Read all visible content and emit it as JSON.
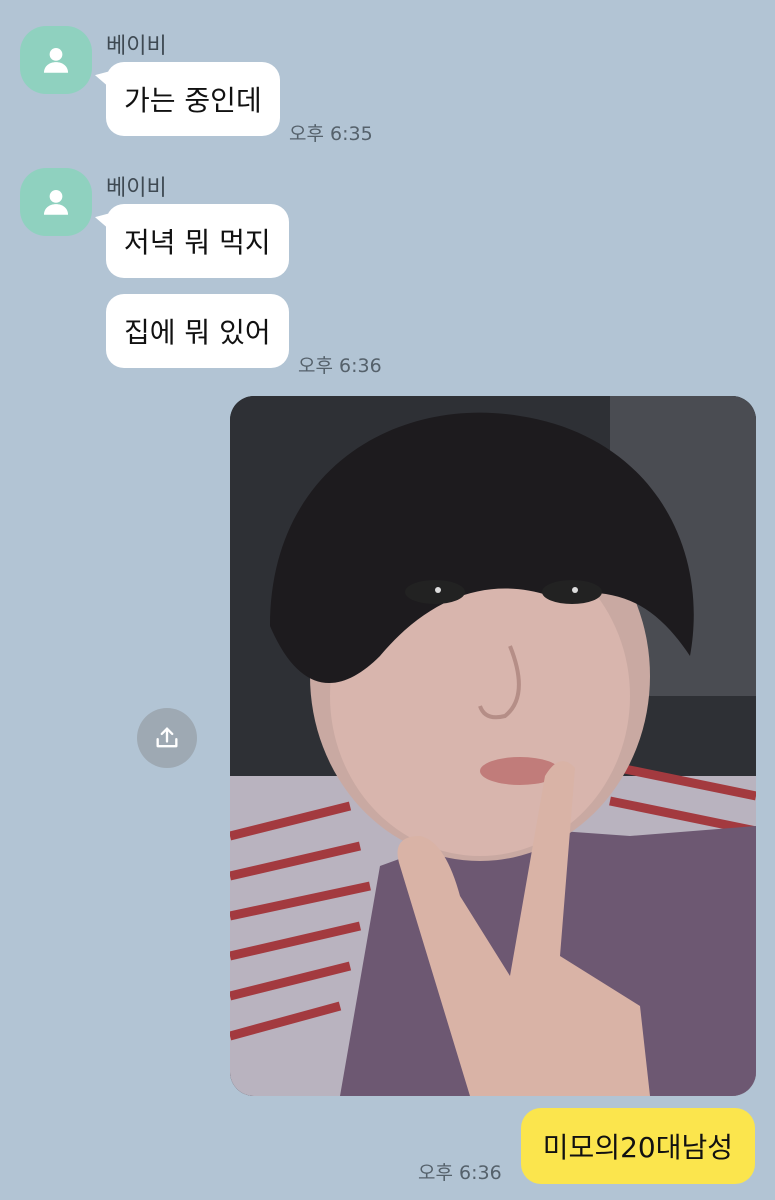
{
  "contact": {
    "name": "베이비",
    "avatar_icon": "person-icon"
  },
  "messages": [
    {
      "from": "contact",
      "show_sender": true,
      "text": "가는 중인데",
      "time": "오후 6:35"
    },
    {
      "from": "contact",
      "show_sender": true,
      "text": "저녁 뭐 먹지",
      "time": ""
    },
    {
      "from": "contact",
      "show_sender": false,
      "text": "집에 뭐 있어",
      "time": "오후 6:36"
    },
    {
      "from": "me",
      "type": "photo",
      "share_icon": "share-icon"
    },
    {
      "from": "me",
      "text": "미모의20대남성",
      "time": "오후 6:36"
    }
  ],
  "colors": {
    "background": "#b2c4d4",
    "incoming_bubble": "#ffffff",
    "outgoing_bubble": "#fbe54d",
    "avatar": "#8fd1bf"
  }
}
